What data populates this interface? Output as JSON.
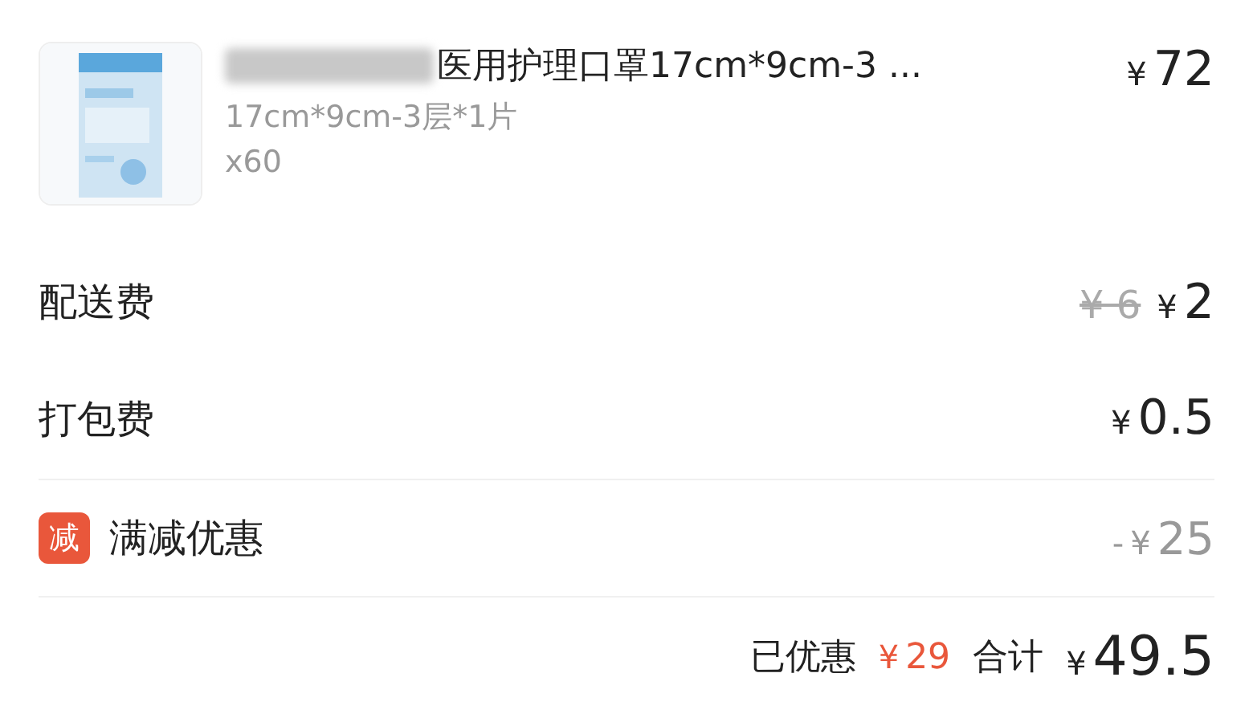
{
  "product": {
    "name": "医用护理口罩17cm*9cm-3 ...",
    "name_redacted": true,
    "spec": "17cm*9cm-3层*1片",
    "quantity": "x60",
    "price": {
      "currency": "¥",
      "amount": "72"
    }
  },
  "fees": [
    {
      "kind": "fee",
      "label": "配送费",
      "original": {
        "currency": "¥",
        "amount": "6"
      },
      "price": {
        "currency": "¥",
        "amount": "2"
      }
    },
    {
      "kind": "fee",
      "label": "打包费",
      "price": {
        "currency": "¥",
        "amount": "0.5"
      }
    },
    {
      "kind": "discount",
      "badge": "减",
      "label": "满减优惠",
      "price": {
        "sign": "-",
        "currency": "¥",
        "amount": "25"
      }
    }
  ],
  "summary": {
    "saved_label": "已优惠",
    "saved": {
      "currency": "¥",
      "amount": "29"
    },
    "total_label": "合计",
    "total": {
      "currency": "¥",
      "amount": "49.5"
    }
  }
}
